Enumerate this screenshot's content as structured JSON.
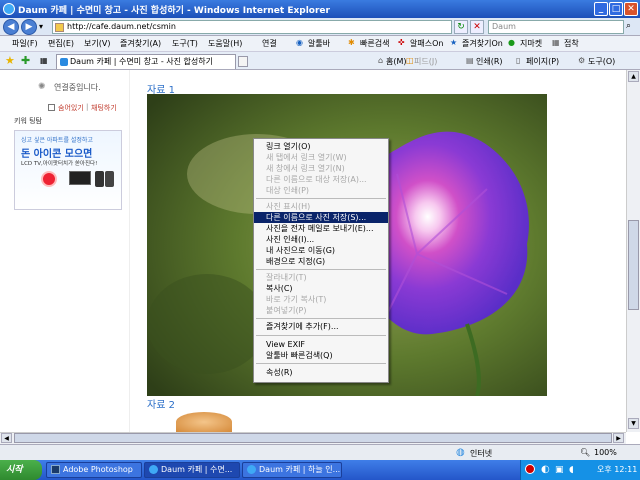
{
  "window": {
    "title": "Daum 카페 | 수면미 창고 - 사진 합성하기 - Windows Internet Explorer"
  },
  "address": {
    "url": "http://cafe.daum.net/csmin",
    "search_placeholder": "Daum"
  },
  "menubar": {
    "items": [
      "파일(F)",
      "편집(E)",
      "보기(V)",
      "즐겨찾기(A)",
      "도구(T)",
      "도움말(H)"
    ],
    "links": [
      "연결",
      "알툴바",
      "빠른검색",
      "알패스On",
      "즐겨찾기On",
      "지마켓",
      "접착"
    ]
  },
  "favbar": {
    "tab_title": "Daum 카페 | 수면미 창고 - 사진 합성하기",
    "commands": [
      "홈(M)",
      "피드(J)",
      "인쇄(R)",
      "페이지(P)",
      "도구(O)"
    ]
  },
  "sidebar": {
    "loading_text": "연결중입니다.",
    "hide_link": "숨어있기",
    "chat_link": "채팅하기",
    "keyword_label": "키워 팅탐",
    "banner_line1": "싱고 싶은 아파트를 설정하고",
    "banner_line2": "돈 아이콘 모으면",
    "banner_line3": "LCD TV,아이팟터치가 쏟아진다!"
  },
  "content": {
    "label1": "자료 1",
    "label2": "자료 2"
  },
  "context_menu": {
    "groups": [
      [
        {
          "label": "링크 열기(O)",
          "enabled": false
        },
        {
          "label": "새 탭에서 링크 열기(W)",
          "enabled": false
        },
        {
          "label": "새 창에서 링크 열기(N)",
          "enabled": false
        },
        {
          "label": "다른 이름으로 대상 저장(A)...",
          "enabled": false
        },
        {
          "label": "대상 인쇄(P)",
          "enabled": false
        }
      ],
      [
        {
          "label": "사진 표시(H)",
          "enabled": false
        },
        {
          "label": "다른 이름으로 사진 저장(S)...",
          "enabled": true,
          "selected": true
        },
        {
          "label": "사진을 전자 메일로 보내기(E)...",
          "enabled": true
        },
        {
          "label": "사진 인쇄(I)...",
          "enabled": true
        },
        {
          "label": "내 사진으로 이동(G)",
          "enabled": true
        },
        {
          "label": "배경으로 지정(G)",
          "enabled": true
        }
      ],
      [
        {
          "label": "잘라내기(T)",
          "enabled": false
        },
        {
          "label": "복사(C)",
          "enabled": true
        },
        {
          "label": "바로 가기 복사(T)",
          "enabled": false
        },
        {
          "label": "붙여넣기(P)",
          "enabled": false
        }
      ],
      [
        {
          "label": "즐겨찾기에 추가(F)...",
          "enabled": true
        }
      ],
      [
        {
          "label": "View EXIF",
          "enabled": true
        },
        {
          "label": "알툴바 빠른검색(Q)",
          "enabled": true
        }
      ],
      [
        {
          "label": "속성(R)",
          "enabled": true
        }
      ]
    ]
  },
  "status": {
    "zone": "인터넷",
    "zoom": "100%"
  },
  "taskbar": {
    "start": "시작",
    "tasks": [
      "Adobe Photoshop",
      "Daum 카페 | 수면...",
      "Daum 카페 | 하늘 인..."
    ],
    "clock": "오후 12:11"
  }
}
